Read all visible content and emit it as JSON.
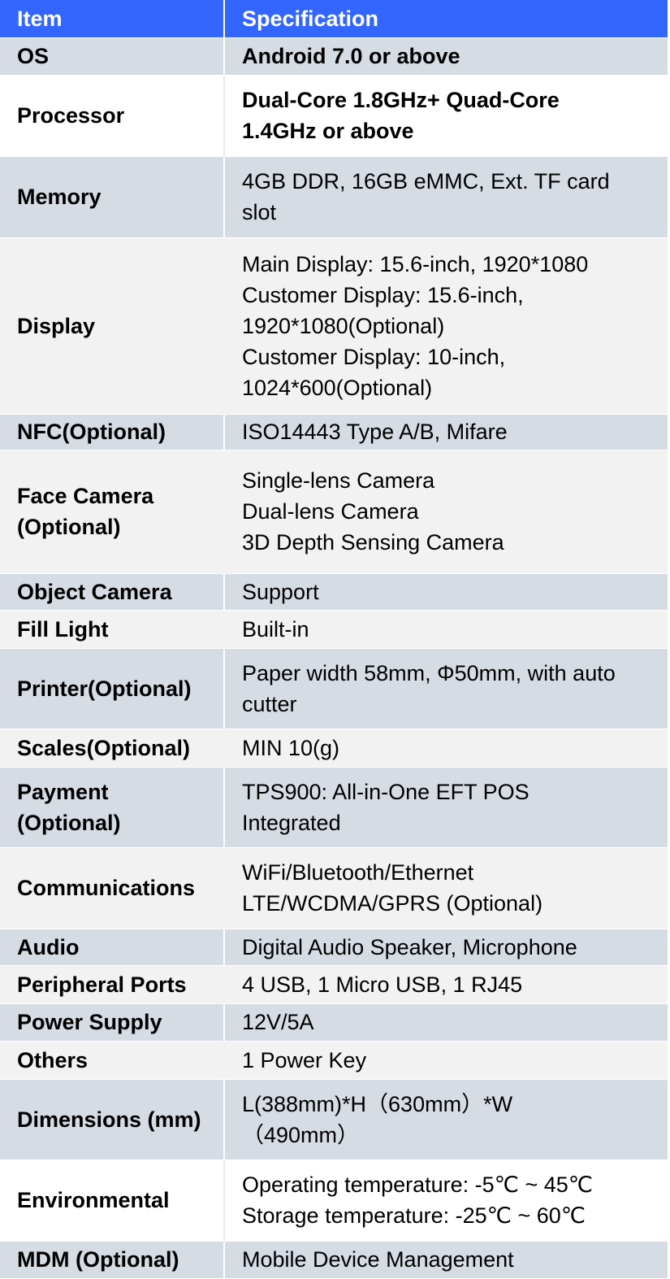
{
  "header": {
    "item": "Item",
    "specification": "Specification"
  },
  "colors": {
    "header_bg": "#3366ff",
    "row_blue_gray": "#d6dce4",
    "row_light_gray": "#f2f2f2",
    "row_white": "#ffffff"
  },
  "rows": [
    {
      "item": "OS",
      "lines": [
        "Android 7.0 or above"
      ]
    },
    {
      "item": "Processor",
      "lines": [
        "Dual-Core 1.8GHz+ Quad-Core",
        "1.4GHz or above"
      ]
    },
    {
      "item": "Memory",
      "lines": [
        "4GB DDR, 16GB eMMC, Ext. TF card",
        "slot"
      ]
    },
    {
      "item": "Display",
      "lines": [
        "Main Display: 15.6-inch, 1920*1080",
        "Customer Display: 15.6-inch,",
        "1920*1080(Optional)",
        "Customer Display: 10-inch,",
        "1024*600(Optional)"
      ]
    },
    {
      "item": "NFC(Optional)",
      "lines": [
        "ISO14443 Type A/B, Mifare"
      ]
    },
    {
      "item": "Face Camera (Optional)",
      "item_lines": [
        "Face Camera",
        "(Optional)"
      ],
      "lines": [
        "Single-lens Camera",
        "Dual-lens Camera",
        "3D Depth Sensing Camera"
      ]
    },
    {
      "item": "Object Camera",
      "lines": [
        "Support"
      ]
    },
    {
      "item": "Fill Light",
      "lines": [
        "Built-in"
      ]
    },
    {
      "item": "Printer(Optional)",
      "lines": [
        "Paper width 58mm, Φ50mm, with auto",
        "cutter"
      ]
    },
    {
      "item": "Scales(Optional)",
      "lines": [
        "MIN 10(g)"
      ]
    },
    {
      "item": "Payment (Optional)",
      "item_lines": [
        "Payment",
        "(Optional)"
      ],
      "lines": [
        "TPS900: All-in-One EFT POS",
        "Integrated"
      ]
    },
    {
      "item": "Communications",
      "lines": [
        "WiFi/Bluetooth/Ethernet",
        "LTE/WCDMA/GPRS (Optional)"
      ]
    },
    {
      "item": "Audio",
      "lines": [
        "Digital Audio Speaker, Microphone"
      ]
    },
    {
      "item": "Peripheral Ports",
      "lines": [
        "4 USB, 1 Micro USB, 1 RJ45"
      ]
    },
    {
      "item": "Power Supply",
      "lines": [
        "12V/5A"
      ]
    },
    {
      "item": "Others",
      "lines": [
        "1 Power Key"
      ]
    },
    {
      "item": "Dimensions (mm)",
      "lines": [
        "L(388mm)*H（630mm）*W",
        "（490mm）"
      ]
    },
    {
      "item": "Environmental",
      "lines": [
        "Operating temperature: -5℃ ~ 45℃",
        "Storage temperature: -25℃ ~ 60℃"
      ]
    },
    {
      "item": "MDM (Optional)",
      "lines": [
        "Mobile Device Management"
      ]
    }
  ]
}
